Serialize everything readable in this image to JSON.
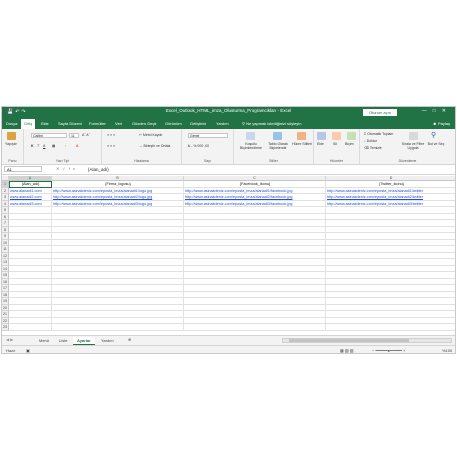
{
  "title": "Excel_Outlook_HTML_imza_Olusturma_Programcikları - Excel",
  "signin": "Oturum açın",
  "menu": [
    "Dosya",
    "Giriş",
    "Ekle",
    "Sayfa Düzeni",
    "Formüller",
    "Veri",
    "Gözden Geçir",
    "Görünüm",
    "Geliştirici",
    "Yardım"
  ],
  "active_menu": "Giriş",
  "tellme": "Ne yapmak istediğinizi söyleyin",
  "share": "Paylaş",
  "ribbon": {
    "clipboard": {
      "paste": "Yapıştır",
      "label": "Pano"
    },
    "font": {
      "name": "Calibri",
      "size": "11",
      "label": "Yazı Tipi"
    },
    "alignment": {
      "wrap": "Metni Kaydır",
      "merge": "Birleştir ve Ortala",
      "label": "Hizalama"
    },
    "number": {
      "format": "Genel",
      "label": "Sayı"
    },
    "styles": {
      "cond": "Koşullu Biçimlendirme",
      "table": "Tablo Olarak Biçimlendir",
      "cell": "Hücre Stilleri",
      "label": "Stiller"
    },
    "cells": {
      "insert": "Ekle",
      "delete": "Sil",
      "format": "Biçim",
      "label": "Hücreler"
    },
    "editing": {
      "autosum": "Otomatik Toplam",
      "fill": "Doldur",
      "clear": "Temizle",
      "sort": "Sırala ve Filtre Uygula",
      "find": "Bul ve Seç",
      "label": "Düzenleme"
    }
  },
  "namebox": "A1",
  "formula": "{Alan_adı}",
  "columns": [
    "A",
    "B",
    "C",
    "D"
  ],
  "rows": [
    [
      "{Alan_adı}",
      "{Firma_logosu}",
      "{Facebook_ikonu}",
      "{Twitter_ikonu}"
    ],
    [
      "www.alanadi1.com",
      "http://www.asinakdeniz.com/eposta_imza/alanadi1/logo.jpg",
      "http://www.asinakdeniz.com/eposta_imza/alanadi1/facebook.jpg",
      "http://www.asinakdeniz.com/eposta_imza/alanadi1/twitter"
    ],
    [
      "www.alanadi2.com",
      "http://www.asinakdeniz.com/eposta_imza/alanadi2/logo.jpg",
      "http://www.asinakdeniz.com/eposta_imza/alanadi2/facebook.jpg",
      "http://www.asinakdeniz.com/eposta_imza/alanadi2/twitter"
    ],
    [
      "www.alanadi3.com",
      "http://www.asinakdeniz.com/eposta_imza/alanadi3/logo.jpg",
      "http://www.asinakdeniz.com/eposta_imza/alanadi3/facebook.jpg",
      "http://www.asinakdeniz.com/eposta_imza/alanadi3/twitter"
    ]
  ],
  "row_numbers": [
    "1",
    "2",
    "3",
    "4",
    "5",
    "6",
    "7",
    "8",
    "9",
    "10",
    "11",
    "12",
    "13",
    "14",
    "15",
    "16",
    "17",
    "18",
    "19",
    "20",
    "21",
    "22",
    "23"
  ],
  "sheets": [
    "Menü",
    "Liste",
    "Ayarlar",
    "Yardım"
  ],
  "active_sheet": "Ayarlar",
  "status": {
    "ready": "Hazır",
    "zoom": "%100"
  },
  "colors": {
    "accent": "#217346",
    "link": "#1f4ed8"
  }
}
